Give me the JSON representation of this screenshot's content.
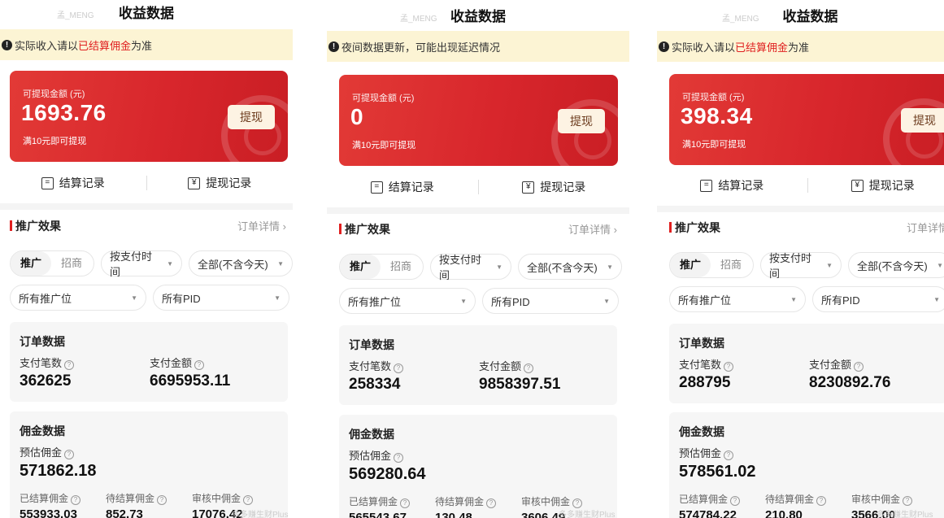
{
  "panels": [
    {
      "title": "收益数据",
      "notice": {
        "prefix": "实际收入请以",
        "highlight": "已结算佣金",
        "suffix": "为准"
      },
      "card": {
        "label": "可提现金额 (元)",
        "amount": "1693.76",
        "sub": "满10元即可提现",
        "button": "提现"
      },
      "records": {
        "settle": "结算记录",
        "withdraw": "提现记录"
      },
      "promo": {
        "title": "推广效果",
        "link": "订单详情"
      },
      "filters": {
        "tab_on": "推广",
        "tab_off": "招商",
        "time": "按支付时间",
        "range": "全部(不含今天)",
        "position": "所有推广位",
        "pid": "所有PID"
      },
      "orders": {
        "title": "订单数据",
        "count_label": "支付笔数",
        "count": "362625",
        "amount_label": "支付金额",
        "amount": "6695953.11"
      },
      "commission": {
        "title": "佣金数据",
        "est_label": "预估佣金",
        "est": "571862.18",
        "settled_label": "已结算佣金",
        "settled": "553933.03",
        "pending_label": "待结算佣金",
        "pending": "852.73",
        "review_label": "审核中佣金",
        "review": "17076.42"
      }
    },
    {
      "title": "收益数据",
      "notice": {
        "prefix": "夜间数据更新，可能出现延迟情况",
        "highlight": "",
        "suffix": ""
      },
      "card": {
        "label": "可提现金额 (元)",
        "amount": "0",
        "sub": "满10元即可提现",
        "button": "提现"
      },
      "records": {
        "settle": "结算记录",
        "withdraw": "提现记录"
      },
      "promo": {
        "title": "推广效果",
        "link": "订单详情"
      },
      "filters": {
        "tab_on": "推广",
        "tab_off": "招商",
        "time": "按支付时间",
        "range": "全部(不含今天)",
        "position": "所有推广位",
        "pid": "所有PID"
      },
      "orders": {
        "title": "订单数据",
        "count_label": "支付笔数",
        "count": "258334",
        "amount_label": "支付金额",
        "amount": "9858397.51"
      },
      "commission": {
        "title": "佣金数据",
        "est_label": "预估佣金",
        "est": "569280.64",
        "settled_label": "已结算佣金",
        "settled": "565543.67",
        "pending_label": "待结算佣金",
        "pending": "130.48",
        "review_label": "审核中佣金",
        "review": "3606.49"
      }
    },
    {
      "title": "收益数据",
      "notice": {
        "prefix": "实际收入请以",
        "highlight": "已结算佣金",
        "suffix": "为准"
      },
      "card": {
        "label": "可提现金额 (元)",
        "amount": "398.34",
        "sub": "满10元即可提现",
        "button": "提现"
      },
      "records": {
        "settle": "结算记录",
        "withdraw": "提现记录"
      },
      "promo": {
        "title": "推广效果",
        "link": "订单详情"
      },
      "filters": {
        "tab_on": "推广",
        "tab_off": "招商",
        "time": "按支付时间",
        "range": "全部(不含今天)",
        "position": "所有推广位",
        "pid": "所有PID"
      },
      "orders": {
        "title": "订单数据",
        "count_label": "支付笔数",
        "count": "288795",
        "amount_label": "支付金额",
        "amount": "8230892.76"
      },
      "commission": {
        "title": "佣金数据",
        "est_label": "预估佣金",
        "est": "578561.02",
        "settled_label": "已结算佣金",
        "settled": "574784.22",
        "pending_label": "待结算佣金",
        "pending": "210.80",
        "review_label": "审核中佣金",
        "review": "3566.00"
      }
    }
  ],
  "watermark": "孟_MENG",
  "footer_mark": "多多赚生财Plus",
  "colors": {
    "accent": "#e02020",
    "card_red": "#d8262c",
    "notice_bg": "#fcf4d4"
  }
}
